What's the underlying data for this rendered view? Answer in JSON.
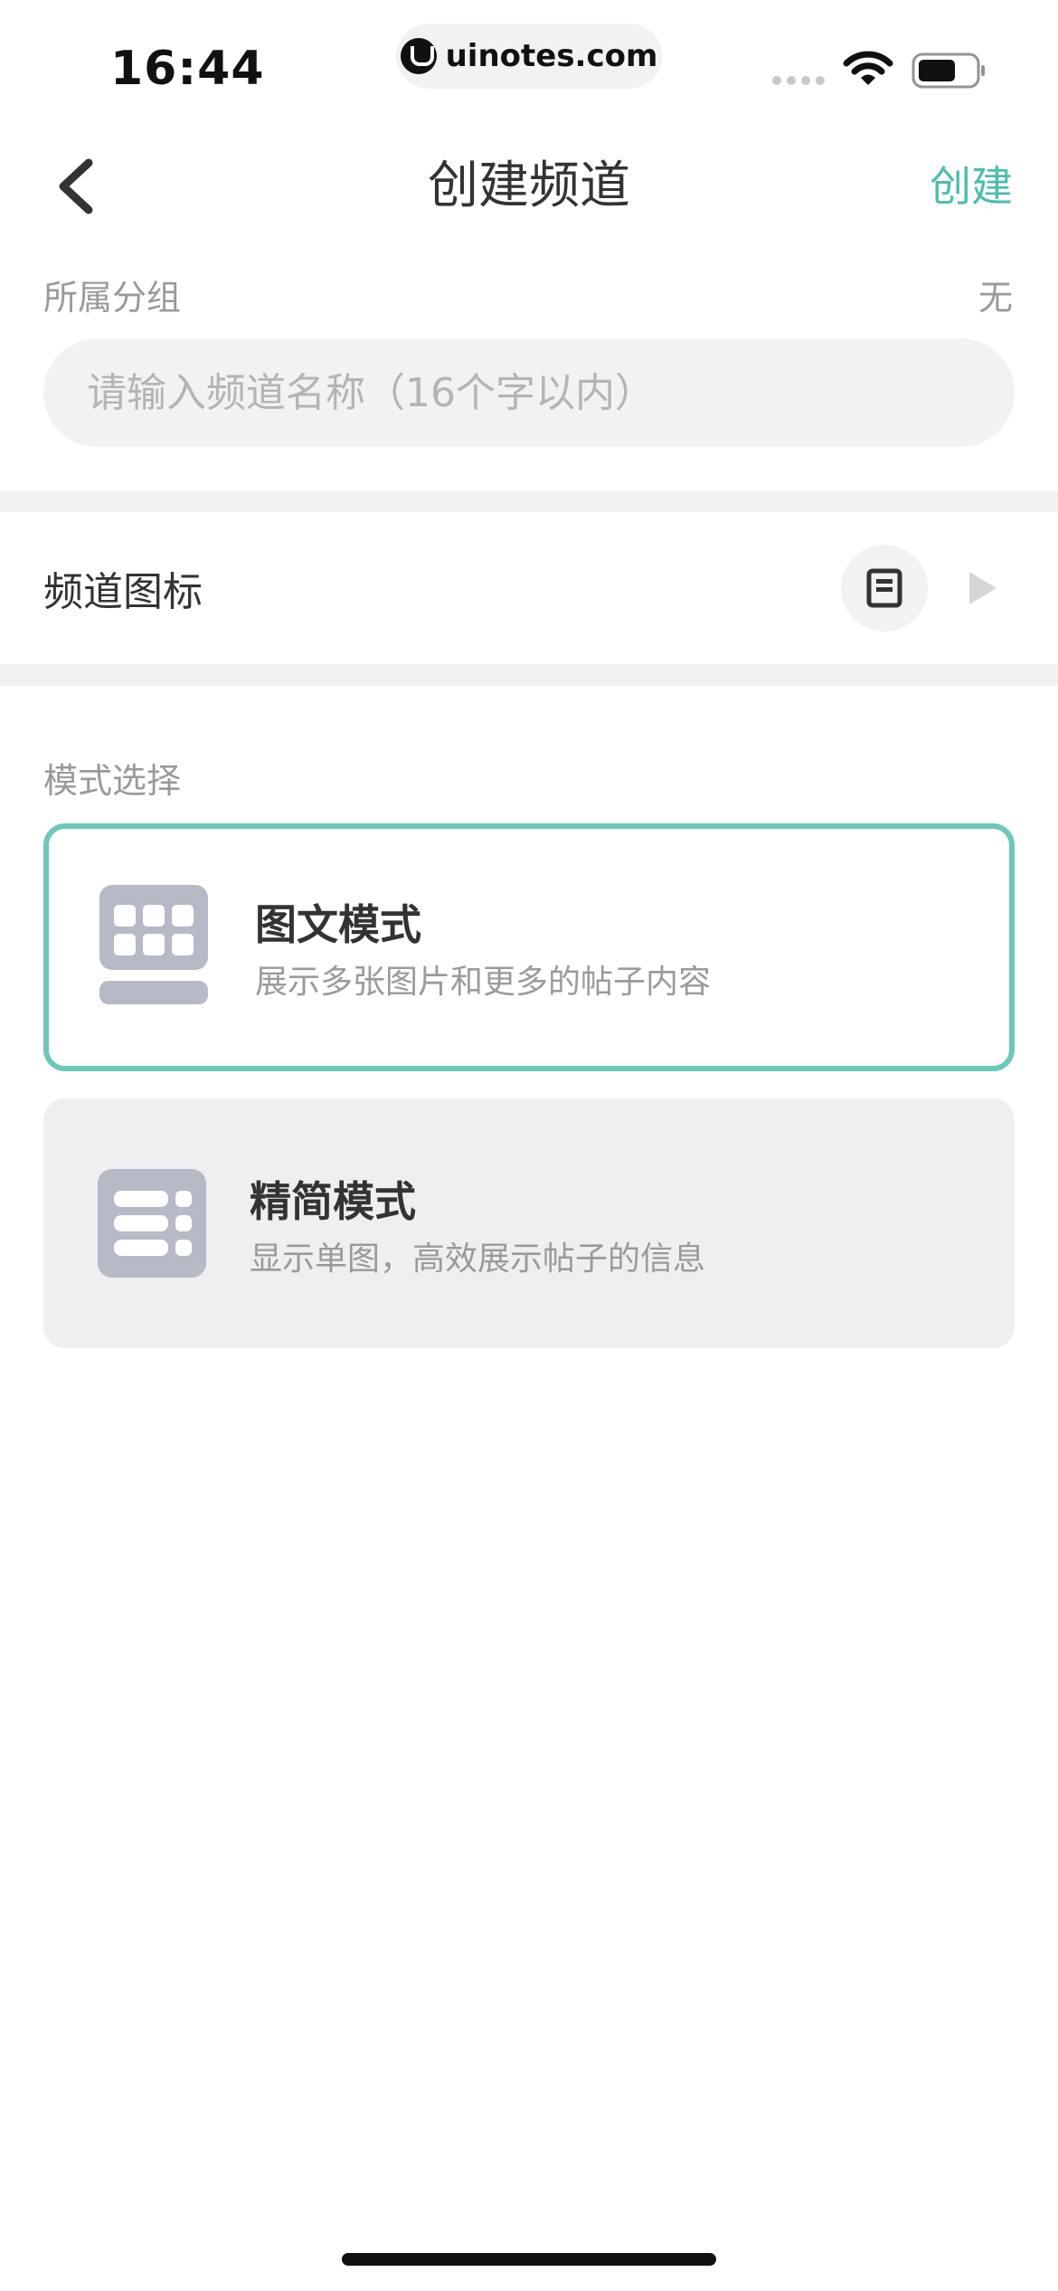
{
  "status_bar": {
    "time": "16:44",
    "url": "uinotes.com",
    "icons": [
      "signal-icon",
      "wifi-icon",
      "battery-icon"
    ]
  },
  "nav": {
    "title": "创建频道",
    "create_label": "创建",
    "back_icon": "chevron-left-icon",
    "accent_color": "#4dbdac"
  },
  "group": {
    "label": "所属分组",
    "value": "无"
  },
  "channel_name": {
    "placeholder": "请输入频道名称（16个字以内）",
    "value": ""
  },
  "channel_icon": {
    "label": "频道图标",
    "icon": "document-icon",
    "arrow_icon": "triangle-right-icon"
  },
  "mode": {
    "section_label": "模式选择",
    "options": [
      {
        "title": "图文模式",
        "description": "展示多张图片和更多的帖子内容",
        "icon": "grid-icon",
        "selected": true
      },
      {
        "title": "精简模式",
        "description": "显示单图，高效展示帖子的信息",
        "icon": "list-icon",
        "selected": false
      }
    ],
    "selected_border_color": "#6cc8b7"
  }
}
